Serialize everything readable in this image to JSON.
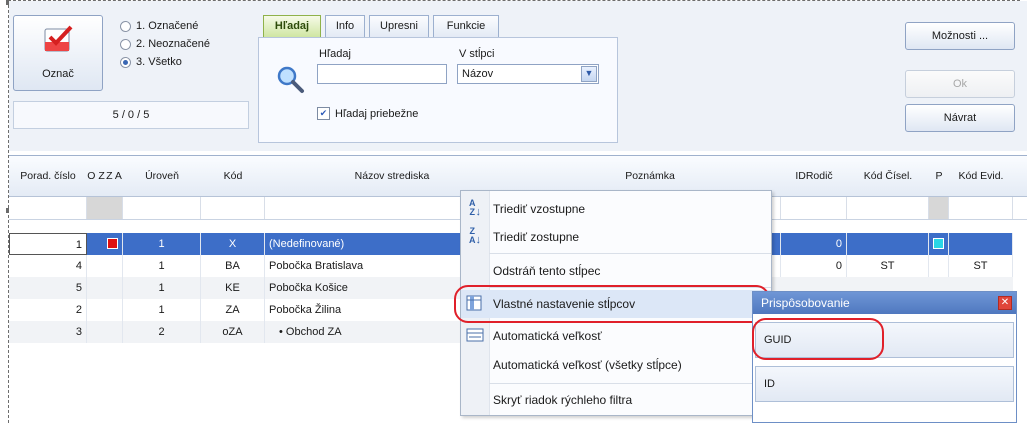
{
  "toolbar": {
    "mark_label": "Označ",
    "radios": [
      {
        "label": "1. Označené",
        "checked": false
      },
      {
        "label": "2. Neoznačené",
        "checked": false
      },
      {
        "label": "3. Všetko",
        "checked": true
      }
    ],
    "counter": "5 / 0 / 5"
  },
  "search": {
    "tabs": [
      "Hľadaj",
      "Info",
      "Upresni",
      "Funkcie"
    ],
    "active_tab": "Hľadaj",
    "search_label": "Hľadaj",
    "search_value": "",
    "column_label": "V stĺpci",
    "column_value": "Názov",
    "live_label": "Hľadaj priebežne",
    "live_checked": true
  },
  "right_buttons": {
    "options": "Možnosti ...",
    "ok": "Ok",
    "back": "Návrat"
  },
  "grid": {
    "columns": [
      "Porad. číslo",
      "O Z",
      "Z A",
      "Úroveň",
      "Kód",
      "Názov strediska",
      "Poznámka",
      "IDRodič",
      "Kód Čísel.",
      "P",
      "Kód Evid."
    ],
    "rows": [
      {
        "num": "1",
        "level": "1",
        "code": "X",
        "name": "(Nedefinované)",
        "idparent": "0",
        "codenum": "",
        "codeevid": "",
        "selected": true
      },
      {
        "num": "4",
        "level": "1",
        "code": "BA",
        "name": "Pobočka Bratislava",
        "idparent": "0",
        "codenum": "ST",
        "codeevid": "ST",
        "selected": false
      },
      {
        "num": "5",
        "level": "1",
        "code": "KE",
        "name": "Pobočka Košice",
        "idparent": "",
        "codenum": "",
        "codeevid": "",
        "selected": false
      },
      {
        "num": "2",
        "level": "1",
        "code": "ZA",
        "name": "Pobočka Žilina",
        "idparent": "",
        "codenum": "",
        "codeevid": "",
        "selected": false
      },
      {
        "num": "3",
        "level": "2",
        "code": "oZA",
        "name": "• Obchod ZA",
        "idparent": "",
        "codenum": "",
        "codeevid": "",
        "selected": false
      }
    ]
  },
  "context_menu": {
    "items": [
      {
        "label": "Triediť vzostupne",
        "icon": "sort-ascending-icon"
      },
      {
        "label": "Triediť zostupne",
        "icon": "sort-descending-icon"
      },
      {
        "label": "Odstráň tento stĺpec",
        "icon": ""
      },
      {
        "label": "Vlastné nastavenie stĺpcov",
        "icon": "column-chooser-icon"
      },
      {
        "label": "Automatická veľkosť",
        "icon": "autosize-icon"
      },
      {
        "label": "Automatická veľkosť (všetky stĺpce)",
        "icon": ""
      },
      {
        "label": "Skryť riadok rýchleho filtra",
        "icon": ""
      }
    ]
  },
  "customize": {
    "title": "Prispôsobovanie",
    "items": [
      "GUID",
      "ID"
    ]
  },
  "colors": {
    "selection": "#3d6ec8",
    "annotation": "#e0202a"
  }
}
